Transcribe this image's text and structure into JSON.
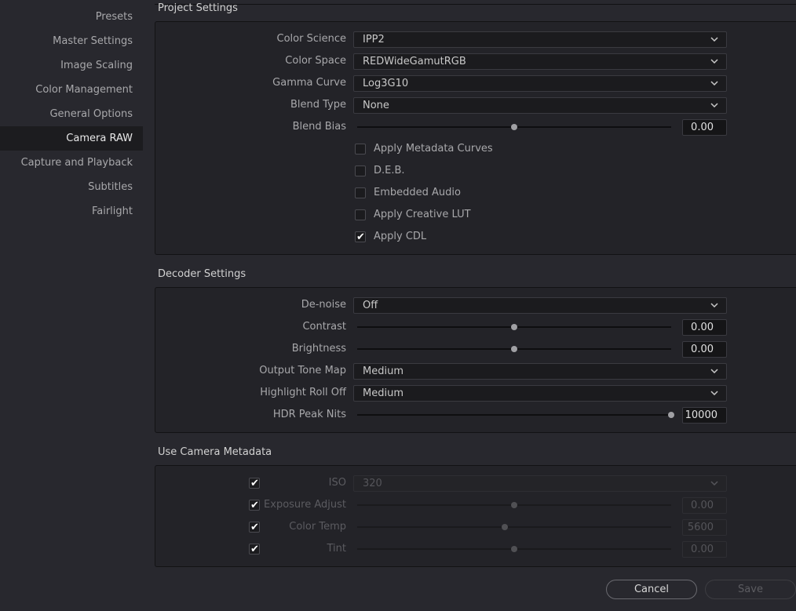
{
  "sidebar": {
    "items": [
      {
        "label": "Presets"
      },
      {
        "label": "Master Settings"
      },
      {
        "label": "Image Scaling"
      },
      {
        "label": "Color Management"
      },
      {
        "label": "General Options"
      },
      {
        "label": "Camera RAW",
        "active": true
      },
      {
        "label": "Capture and Playback"
      },
      {
        "label": "Subtitles"
      },
      {
        "label": "Fairlight"
      }
    ]
  },
  "project": {
    "title": "Project Settings",
    "color_science": {
      "label": "Color Science",
      "value": "IPP2"
    },
    "color_space": {
      "label": "Color Space",
      "value": "REDWideGamutRGB"
    },
    "gamma_curve": {
      "label": "Gamma Curve",
      "value": "Log3G10"
    },
    "blend_type": {
      "label": "Blend Type",
      "value": "None"
    },
    "blend_bias": {
      "label": "Blend Bias",
      "value": "0.00",
      "level": 0.5
    },
    "checks": [
      {
        "label": "Apply Metadata Curves",
        "checked": false
      },
      {
        "label": "D.E.B.",
        "checked": false
      },
      {
        "label": "Embedded Audio",
        "checked": false
      },
      {
        "label": "Apply Creative LUT",
        "checked": false
      },
      {
        "label": "Apply CDL",
        "checked": true
      }
    ]
  },
  "decoder": {
    "title": "Decoder Settings",
    "denoise": {
      "label": "De-noise",
      "value": "Off"
    },
    "contrast": {
      "label": "Contrast",
      "value": "0.00",
      "level": 0.5
    },
    "brightness": {
      "label": "Brightness",
      "value": "0.00",
      "level": 0.5
    },
    "output_tone_map": {
      "label": "Output Tone Map",
      "value": "Medium"
    },
    "highlight_roll_off": {
      "label": "Highlight Roll Off",
      "value": "Medium"
    },
    "hdr_peak_nits": {
      "label": "HDR Peak Nits",
      "value": "10000",
      "level": 1.0
    }
  },
  "metadata": {
    "title": "Use Camera Metadata",
    "iso": {
      "label": "ISO",
      "value": "320",
      "checked": true
    },
    "exposure_adjust": {
      "label": "Exposure Adjust",
      "value": "0.00",
      "level": 0.5,
      "checked": true
    },
    "color_temp": {
      "label": "Color Temp",
      "value": "5600",
      "level": 0.47,
      "checked": true
    },
    "tint": {
      "label": "Tint",
      "value": "0.00",
      "level": 0.5,
      "checked": true
    }
  },
  "buttons": {
    "cancel": "Cancel",
    "save": "Save"
  },
  "icons": {
    "dropdown": "chevron-down-icon",
    "check": "checkmark-icon"
  },
  "colors": {
    "background": "#28282e",
    "panel": "#232328",
    "active_item": "#1c1c1f"
  }
}
